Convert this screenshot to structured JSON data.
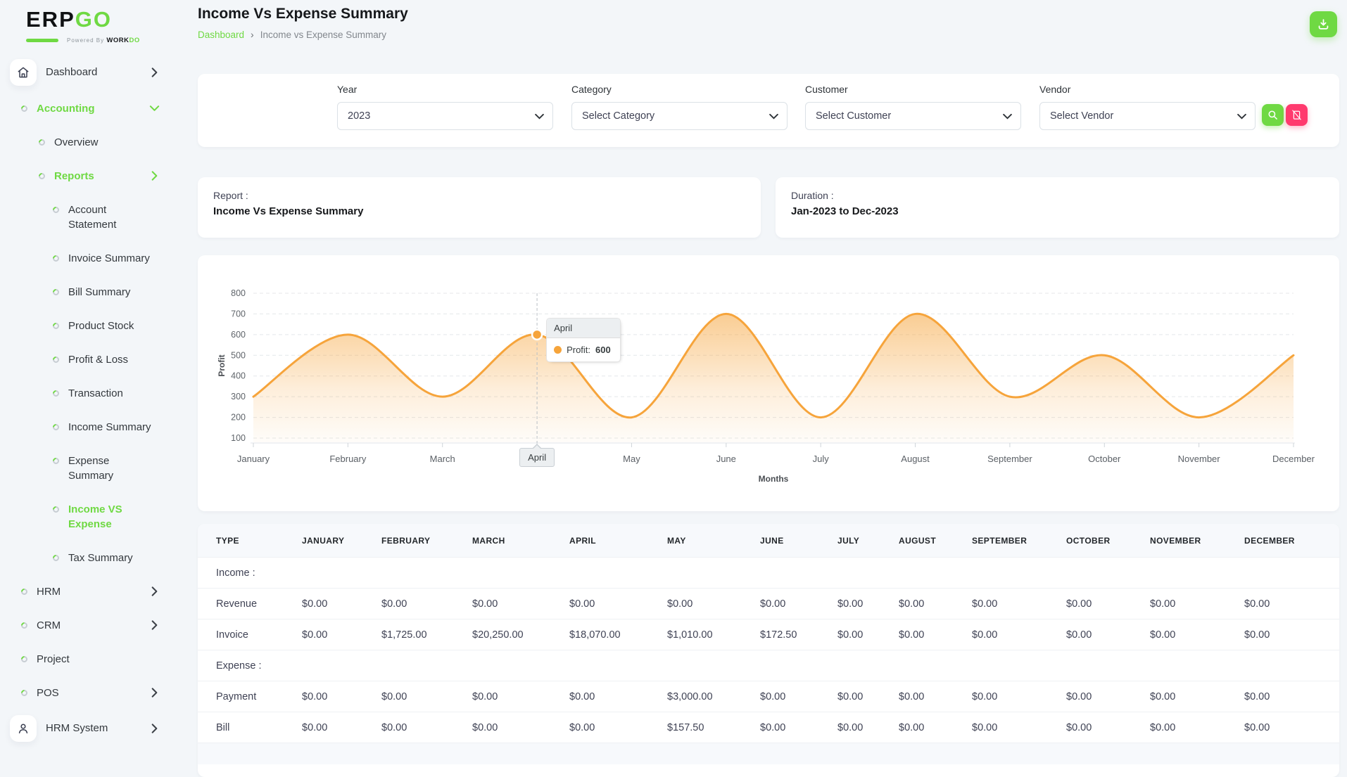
{
  "brand": {
    "name_black": "ERP",
    "name_green": "GO",
    "powered_by": "Powered By",
    "powered_black": "WORK",
    "powered_green": "DO"
  },
  "colors": {
    "accent_green": "#6fd943",
    "danger_pink": "#ff3a6e",
    "chart_orange": "#f6a43b"
  },
  "header": {
    "title": "Income Vs Expense Summary",
    "breadcrumb_home": "Dashboard",
    "breadcrumb_sep": "›",
    "breadcrumb_current": "Income vs Expense Summary"
  },
  "sidebar": {
    "items": [
      {
        "label": "Dashboard",
        "level": 1,
        "icon": "home-icon",
        "boxed": true,
        "chevron": "right"
      },
      {
        "label": "Accounting",
        "level": 1,
        "icon": "donut-icon",
        "chevron": "down",
        "active": true
      },
      {
        "label": "Overview",
        "level": 2,
        "icon": "donut-icon"
      },
      {
        "label": "Reports",
        "level": 2,
        "icon": "donut-icon",
        "chevron": "right",
        "active": true
      },
      {
        "label": "Account\nStatement",
        "level": 3,
        "icon": "donut-icon"
      },
      {
        "label": "Invoice Summary",
        "level": 3,
        "icon": "donut-icon"
      },
      {
        "label": "Bill Summary",
        "level": 3,
        "icon": "donut-icon"
      },
      {
        "label": "Product Stock",
        "level": 3,
        "icon": "donut-icon"
      },
      {
        "label": "Profit & Loss",
        "level": 3,
        "icon": "donut-icon"
      },
      {
        "label": "Transaction",
        "level": 3,
        "icon": "donut-icon"
      },
      {
        "label": "Income Summary",
        "level": 3,
        "icon": "donut-icon"
      },
      {
        "label": "Expense\nSummary",
        "level": 3,
        "icon": "donut-icon"
      },
      {
        "label": "Income VS\nExpense",
        "level": 3,
        "icon": "donut-icon",
        "active": true
      },
      {
        "label": "Tax Summary",
        "level": 3,
        "icon": "donut-icon"
      },
      {
        "label": "HRM",
        "level": 1,
        "icon": "donut-icon",
        "chevron": "right"
      },
      {
        "label": "CRM",
        "level": 1,
        "icon": "donut-icon",
        "chevron": "right"
      },
      {
        "label": "Project",
        "level": 1,
        "icon": "donut-icon"
      },
      {
        "label": "POS",
        "level": 1,
        "icon": "donut-icon",
        "chevron": "right"
      },
      {
        "label": "HRM System",
        "level": 1,
        "icon": "user-icon",
        "boxed": true,
        "chevron": "right"
      }
    ]
  },
  "filters": {
    "year_label": "Year",
    "year_value": "2023",
    "category_label": "Category",
    "category_value": "Select Category",
    "customer_label": "Customer",
    "customer_value": "Select Customer",
    "vendor_label": "Vendor",
    "vendor_value": "Select Vendor"
  },
  "summary": {
    "report_label": "Report :",
    "report_value": "Income Vs Expense Summary",
    "duration_label": "Duration :",
    "duration_value": "Jan-2023 to Dec-2023"
  },
  "chart_data": {
    "type": "area",
    "x": [
      "January",
      "February",
      "March",
      "April",
      "May",
      "June",
      "July",
      "August",
      "September",
      "October",
      "November",
      "December"
    ],
    "series": [
      {
        "name": "Profit",
        "values": [
          300,
          600,
          300,
          600,
          200,
          700,
          200,
          700,
          300,
          500,
          200,
          500
        ]
      }
    ],
    "xlabel": "Months",
    "ylabel": "Profit",
    "ylim": [
      100,
      800
    ],
    "ytick_step": 100,
    "grid": "dashed-horizontal",
    "legend": "none",
    "line_color": "#f6a43b",
    "fill": "gradient",
    "selected_point": {
      "x_index": 3,
      "x_label": "April",
      "series_label": "Profit:",
      "value": "600"
    }
  },
  "table": {
    "columns": [
      "TYPE",
      "JANUARY",
      "FEBRUARY",
      "MARCH",
      "APRIL",
      "MAY",
      "JUNE",
      "JULY",
      "AUGUST",
      "SEPTEMBER",
      "OCTOBER",
      "NOVEMBER",
      "DECEMBER"
    ],
    "rows": [
      {
        "type": "section",
        "cells": [
          "Income :"
        ]
      },
      {
        "type": "data",
        "cells": [
          "Revenue",
          "$0.00",
          "$0.00",
          "$0.00",
          "$0.00",
          "$0.00",
          "$0.00",
          "$0.00",
          "$0.00",
          "$0.00",
          "$0.00",
          "$0.00",
          "$0.00"
        ]
      },
      {
        "type": "data",
        "cells": [
          "Invoice",
          "$0.00",
          "$1,725.00",
          "$20,250.00",
          "$18,070.00",
          "$1,010.00",
          "$172.50",
          "$0.00",
          "$0.00",
          "$0.00",
          "$0.00",
          "$0.00",
          "$0.00"
        ]
      },
      {
        "type": "section",
        "cells": [
          "Expense :"
        ]
      },
      {
        "type": "data",
        "cells": [
          "Payment",
          "$0.00",
          "$0.00",
          "$0.00",
          "$0.00",
          "$3,000.00",
          "$0.00",
          "$0.00",
          "$0.00",
          "$0.00",
          "$0.00",
          "$0.00",
          "$0.00"
        ]
      },
      {
        "type": "data",
        "cells": [
          "Bill",
          "$0.00",
          "$0.00",
          "$0.00",
          "$0.00",
          "$157.50",
          "$0.00",
          "$0.00",
          "$0.00",
          "$0.00",
          "$0.00",
          "$0.00",
          "$0.00"
        ]
      },
      {
        "type": "partial",
        "cells": []
      }
    ]
  }
}
